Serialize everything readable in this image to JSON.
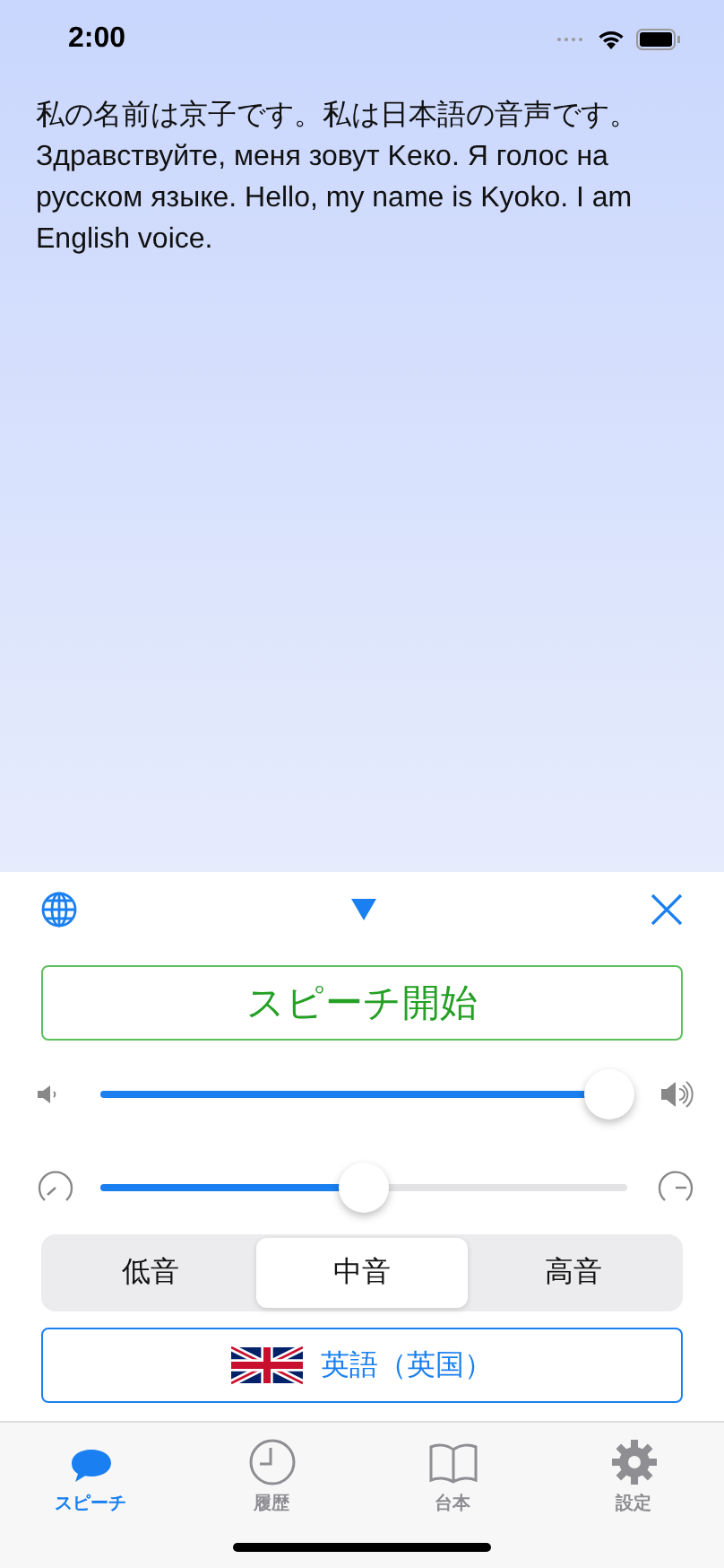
{
  "status_bar": {
    "time": "2:00"
  },
  "speech_text": "私の名前は京子です。私は日本語の音声です。Здравствуйте, меня зовут Keко. Я голос на русском языке. Hello, my name is Kyoko. I am English voice.",
  "panel": {
    "start_button": "スピーチ開始",
    "volume": {
      "level": 0.96
    },
    "speed": {
      "level": 0.5
    },
    "pitch": [
      {
        "label": "低音",
        "selected": false
      },
      {
        "label": "中音",
        "selected": true
      },
      {
        "label": "高音",
        "selected": false
      }
    ],
    "voice_button": "英語（英国）"
  },
  "tab_bar": [
    {
      "kind": "speech",
      "label": "スピーチ",
      "selected": true
    },
    {
      "kind": "history",
      "label": "履歴",
      "selected": false
    },
    {
      "kind": "script",
      "label": "台本",
      "selected": false
    },
    {
      "kind": "settings",
      "label": "設定",
      "selected": false
    }
  ]
}
